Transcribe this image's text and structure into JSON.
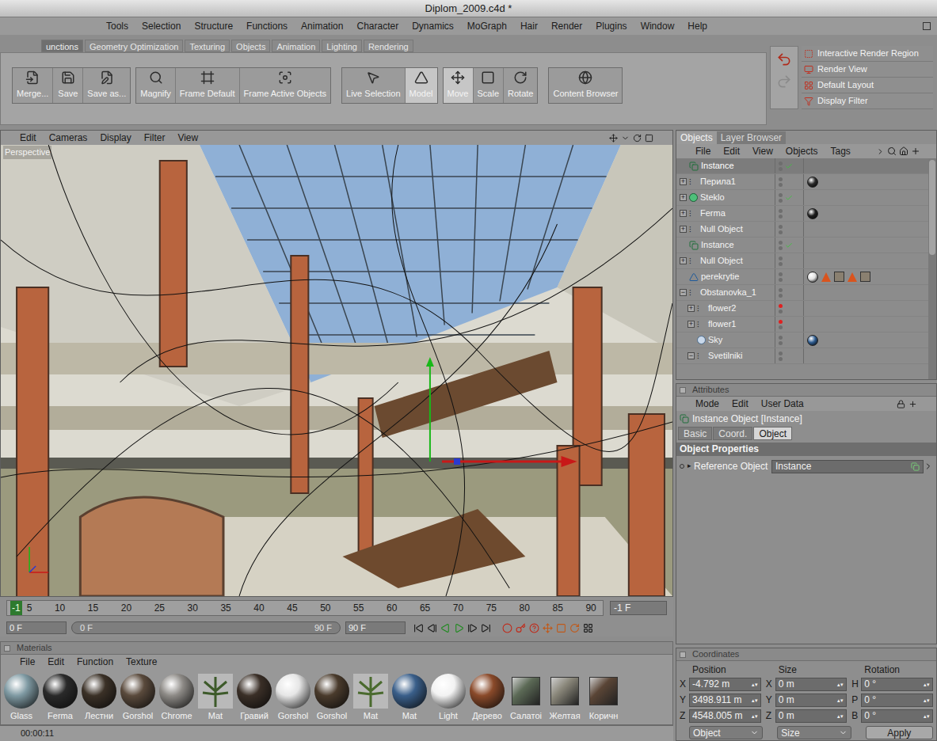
{
  "window": {
    "title": "Diplom_2009.c4d *"
  },
  "menu": [
    "Tools",
    "Selection",
    "Structure",
    "Functions",
    "Animation",
    "Character",
    "Dynamics",
    "MoGraph",
    "Hair",
    "Render",
    "Plugins",
    "Window",
    "Help"
  ],
  "layout_tabs": [
    {
      "label": "unctions",
      "selected": true
    },
    {
      "label": "Geometry Optimization",
      "selected": false
    },
    {
      "label": "Texturing",
      "selected": false
    },
    {
      "label": "Objects",
      "selected": false
    },
    {
      "label": "Animation",
      "selected": false
    },
    {
      "label": "Lighting",
      "selected": false
    },
    {
      "label": "Rendering",
      "selected": false
    }
  ],
  "toolbar": {
    "groups": [
      [
        {
          "label": "Merge...",
          "selected": false
        },
        {
          "label": "Save",
          "selected": false
        },
        {
          "label": "Save as...",
          "selected": false
        }
      ],
      [
        {
          "label": "Magnify",
          "selected": false
        },
        {
          "label": "Frame Default",
          "selected": false
        },
        {
          "label": "Frame Active Objects",
          "selected": false
        }
      ],
      [
        {
          "label": "Live Selection",
          "selected": false
        },
        {
          "label": "Model",
          "selected": true
        }
      ],
      [
        {
          "label": "Move",
          "selected": true
        },
        {
          "label": "Scale",
          "selected": false
        },
        {
          "label": "Rotate",
          "selected": false
        }
      ],
      [
        {
          "label": "Content Browser",
          "selected": false
        }
      ]
    ]
  },
  "quick_panel": [
    "Interactive Render Region",
    "Render View",
    "Default Layout",
    "Display Filter"
  ],
  "viewport": {
    "menu": [
      "Edit",
      "Cameras",
      "Display",
      "Filter",
      "View"
    ],
    "label": "Perspective"
  },
  "timeline": {
    "current": "-1",
    "ticks": [
      "5",
      "10",
      "15",
      "20",
      "25",
      "30",
      "35",
      "40",
      "45",
      "50",
      "55",
      "60",
      "65",
      "70",
      "75",
      "80",
      "85",
      "90"
    ],
    "frame_field": "-1 F"
  },
  "playback": {
    "start": "0 F",
    "slider_start": "0 F",
    "slider_end": "90 F",
    "end": "90 F"
  },
  "materials": {
    "title": "Materials",
    "menu": [
      "File",
      "Edit",
      "Function",
      "Texture"
    ],
    "items": [
      {
        "name": "Glass",
        "kind": "sphere",
        "color": "#7f9aa3"
      },
      {
        "name": "Ferma",
        "kind": "sphere",
        "color": "#2a2a2a"
      },
      {
        "name": "Лестни",
        "kind": "sphere",
        "color": "#3b3127"
      },
      {
        "name": "Gorshol",
        "kind": "sphere",
        "color": "#5a4a3c"
      },
      {
        "name": "Chrome",
        "kind": "sphere",
        "color": "#8d8a86"
      },
      {
        "name": "Mat",
        "kind": "plant",
        "color": "#3d5a2a"
      },
      {
        "name": "Гравий",
        "kind": "sphere",
        "color": "#3a2f27"
      },
      {
        "name": "Gorshol",
        "kind": "sphere",
        "color": "#e6e6e6"
      },
      {
        "name": "Gorshol",
        "kind": "sphere",
        "color": "#4a3b2c"
      },
      {
        "name": "Mat",
        "kind": "plant",
        "color": "#4a6a2e"
      },
      {
        "name": "Mat",
        "kind": "sphere",
        "color": "#3a5f8a"
      },
      {
        "name": "Light",
        "kind": "sphere",
        "color": "#f2f2f2"
      },
      {
        "name": "Дерево",
        "kind": "sphere",
        "color": "#8a4a2a"
      },
      {
        "name": "Салатоі",
        "kind": "cube",
        "color": "#5c6a56"
      },
      {
        "name": "Желтая",
        "kind": "cube",
        "color": "#8a877a"
      },
      {
        "name": "Коричн",
        "kind": "cube",
        "color": "#5a4536"
      }
    ]
  },
  "status_bar": {
    "time": "00:00:11"
  },
  "objects": {
    "tabs": [
      {
        "label": "Objects",
        "selected": true
      },
      {
        "label": "Layer Browser",
        "selected": false
      }
    ],
    "menu": [
      "File",
      "Edit",
      "View",
      "Objects",
      "Tags"
    ],
    "rows": [
      {
        "label": "Instance",
        "kind": "instance",
        "depth": 0,
        "expandable": false,
        "expanded": false,
        "selected": true,
        "check": true,
        "hidden": false,
        "tags": []
      },
      {
        "label": "Перила1",
        "kind": "null",
        "depth": 0,
        "expandable": true,
        "expanded": false,
        "selected": false,
        "check": false,
        "hidden": false,
        "tags": [
          {
            "kind": "material",
            "color": "#2b2b2b"
          }
        ]
      },
      {
        "label": "Steklo",
        "kind": "sphere",
        "depth": 0,
        "expandable": true,
        "expanded": false,
        "selected": false,
        "check": true,
        "hidden": false,
        "tags": []
      },
      {
        "label": "Ferma",
        "kind": "null",
        "depth": 0,
        "expandable": true,
        "expanded": false,
        "selected": false,
        "check": false,
        "hidden": false,
        "tags": [
          {
            "kind": "material",
            "color": "#1e1e1e"
          }
        ]
      },
      {
        "label": "Null Object",
        "kind": "null",
        "depth": 0,
        "expandable": true,
        "expanded": false,
        "selected": false,
        "check": false,
        "hidden": false,
        "tags": []
      },
      {
        "label": "Instance",
        "kind": "instance",
        "depth": 0,
        "expandable": false,
        "expanded": false,
        "selected": false,
        "check": true,
        "hidden": false,
        "tags": []
      },
      {
        "label": "Null Object",
        "kind": "null",
        "depth": 0,
        "expandable": true,
        "expanded": false,
        "selected": false,
        "check": false,
        "hidden": false,
        "tags": []
      },
      {
        "label": "perekrytie",
        "kind": "polygon",
        "depth": 0,
        "expandable": false,
        "expanded": false,
        "selected": false,
        "check": false,
        "hidden": false,
        "tags": [
          {
            "kind": "material",
            "color": "#e0e0e0"
          },
          {
            "kind": "phong",
            "color": "#d9541e"
          },
          {
            "kind": "texture",
            "color": "#8a8070"
          },
          {
            "kind": "phong",
            "color": "#d9541e"
          },
          {
            "kind": "texture",
            "color": "#8a8070"
          }
        ]
      },
      {
        "label": "Obstanovka_1",
        "kind": "null",
        "depth": 0,
        "expandable": true,
        "expanded": true,
        "selected": false,
        "check": false,
        "hidden": false,
        "tags": []
      },
      {
        "label": "flower2",
        "kind": "null",
        "depth": 1,
        "expandable": true,
        "expanded": false,
        "selected": false,
        "check": false,
        "hidden": true,
        "tags": []
      },
      {
        "label": "flower1",
        "kind": "null",
        "depth": 1,
        "expandable": true,
        "expanded": false,
        "selected": false,
        "check": false,
        "hidden": true,
        "tags": []
      },
      {
        "label": "Sky",
        "kind": "sky",
        "depth": 1,
        "expandable": false,
        "expanded": false,
        "selected": false,
        "check": false,
        "hidden": false,
        "tags": [
          {
            "kind": "material",
            "color": "#2d5b8f"
          }
        ]
      },
      {
        "label": "Svetilniki",
        "kind": "null",
        "depth": 1,
        "expandable": true,
        "expanded": true,
        "selected": false,
        "check": false,
        "hidden": false,
        "tags": []
      }
    ]
  },
  "attributes": {
    "title": "Attributes",
    "menu": [
      "Mode",
      "Edit",
      "User Data"
    ],
    "heading": "Instance Object [Instance]",
    "tabs": [
      {
        "label": "Basic",
        "selected": false
      },
      {
        "label": "Coord.",
        "selected": false
      },
      {
        "label": "Object",
        "selected": true
      }
    ],
    "section": "Object Properties",
    "fields": [
      {
        "label": "Reference Object",
        "value": "Instance"
      }
    ]
  },
  "coordinates": {
    "title": "Coordinates",
    "columns": [
      {
        "title": "Position",
        "rows": [
          {
            "axis": "X",
            "value": "-4.792 m"
          },
          {
            "axis": "Y",
            "value": "3498.911 m"
          },
          {
            "axis": "Z",
            "value": "4548.005 m"
          }
        ]
      },
      {
        "title": "Size",
        "rows": [
          {
            "axis": "X",
            "value": "0 m"
          },
          {
            "axis": "Y",
            "value": "0 m"
          },
          {
            "axis": "Z",
            "value": "0 m"
          }
        ]
      },
      {
        "title": "Rotation",
        "rows": [
          {
            "axis": "H",
            "value": "0 °"
          },
          {
            "axis": "P",
            "value": "0 °"
          },
          {
            "axis": "B",
            "value": "0 °"
          }
        ]
      }
    ],
    "dropdowns": [
      "Object",
      "Size"
    ],
    "apply": "Apply"
  }
}
